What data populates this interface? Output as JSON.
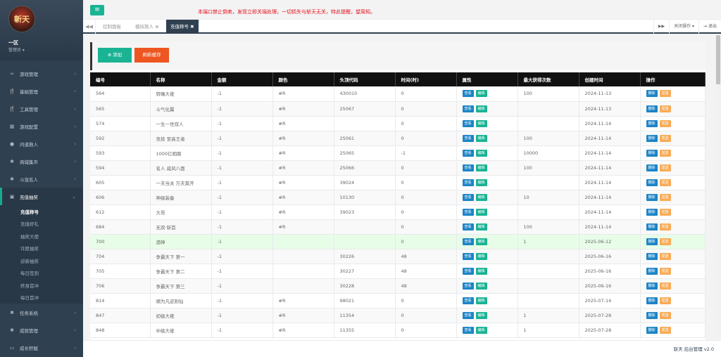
{
  "sidebar": {
    "logo_text": "斬天",
    "region": "一区",
    "role": "管理员",
    "menu": [
      {
        "icon": "∞",
        "label": "游戏管理"
      },
      {
        "icon": "🍴",
        "label": "基础管理"
      },
      {
        "icon": "🍴",
        "label": "工具管理"
      },
      {
        "icon": "▦",
        "label": "游戏配置"
      },
      {
        "icon": "●",
        "label": "问道救人"
      },
      {
        "icon": "✱",
        "label": "商城集市"
      },
      {
        "icon": "✱",
        "label": "斗宠名人"
      },
      {
        "icon": "▣",
        "label": "充值抽奖"
      }
    ],
    "submenu": [
      "充值称号",
      "充值好礼",
      "抽奖大使",
      "许愿抽奖",
      "迎新抽奖",
      "每日签到",
      "终身首冲",
      "每日首冲"
    ],
    "menu_after": [
      {
        "icon": "✱",
        "label": "任务系统"
      },
      {
        "icon": "✱",
        "label": "成就管理"
      },
      {
        "icon": "▭",
        "label": "成长积赋"
      }
    ]
  },
  "top": {
    "warning": "本端口禁止倒卖，发现立即关端处理，一切损失与斩天无关，特此提醒，望周知。"
  },
  "tabs": {
    "items": [
      "控制面板",
      "模拟救人",
      "充值称号"
    ],
    "close_all": "关闭操作",
    "logout": "退出"
  },
  "toolbar": {
    "add": "添加",
    "refresh": "刷新缓存"
  },
  "table": {
    "headers": [
      "编号",
      "名称",
      "金额",
      "颜色",
      "头顶代码",
      "时间(时)",
      "属性",
      "最大获得次数",
      "创建时间",
      "操作"
    ],
    "btn_view": "查看",
    "btn_edit": "编辑",
    "btn_delete": "删除",
    "btn_send": "发送",
    "rows": [
      [
        "564",
        "转嘴大佬",
        "-1",
        "#R",
        "430010",
        "0",
        "100",
        "2024-11-13"
      ],
      [
        "565",
        "斗气化翼",
        "-1",
        "#R",
        "25067",
        "0",
        "",
        "2024-11-13"
      ],
      [
        "574",
        "一生一世双人",
        "-1",
        "#R",
        "",
        "0",
        "",
        "2024-11-14"
      ],
      [
        "592",
        "竞技 至高王者",
        "-1",
        "#R",
        "25061",
        "0",
        "100",
        "2024-11-14"
      ],
      [
        "593",
        "1000亿相腐",
        "-1",
        "#R",
        "25065",
        "-1",
        "10000",
        "2024-11-14"
      ],
      [
        "594",
        "名人 威风八面",
        "-1",
        "#R",
        "25066",
        "0",
        "100",
        "2024-11-14"
      ],
      [
        "605",
        "一夫当关 万夫莫开",
        "-1",
        "#R",
        "39024",
        "0",
        "",
        "2024-11-14"
      ],
      [
        "606",
        "神级装备",
        "-1",
        "#R",
        "10130",
        "0",
        "10",
        "2024-11-14"
      ],
      [
        "612",
        "大哥",
        "-1",
        "#R",
        "39023",
        "0",
        "",
        "2024-11-14"
      ],
      [
        "684",
        "无双·斩首",
        "-1",
        "#R",
        "",
        "0",
        "100",
        "2024-11-14"
      ],
      [
        "700",
        "酒神",
        "-1",
        "",
        "",
        "0",
        "1",
        "2025-06-12"
      ],
      [
        "704",
        "争霸天下 第一",
        "-1",
        "",
        "30226",
        "48",
        "",
        "2025-06-16"
      ],
      [
        "705",
        "争霸天下 第二",
        "-1",
        "",
        "30227",
        "48",
        "",
        "2025-06-16"
      ],
      [
        "706",
        "争霸天下 第三",
        "-1",
        "",
        "30228",
        "48",
        "",
        "2025-06-16"
      ],
      [
        "814",
        "顺为凡逆则仙",
        "-1",
        "#R",
        "98021",
        "0",
        "",
        "2025-07-14"
      ],
      [
        "847",
        "初级大佬",
        "-1",
        "#R",
        "11354",
        "0",
        "1",
        "2025-07-28"
      ],
      [
        "848",
        "中级大佬",
        "-1",
        "#R",
        "11355",
        "0",
        "1",
        "2025-07-28"
      ]
    ]
  },
  "footer": {
    "text": "斩天 后台管理 v2.0"
  }
}
